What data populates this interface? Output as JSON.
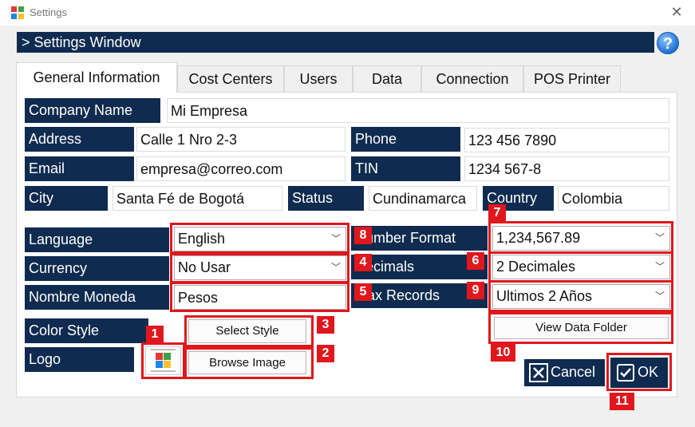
{
  "window": {
    "title": "Settings",
    "close_icon": "close-icon"
  },
  "header": {
    "title": "> Settings Window",
    "help": "?"
  },
  "tabs": [
    "General Information",
    "Cost Centers",
    "Users",
    "Data",
    "Connection",
    "POS Printer"
  ],
  "form": {
    "company_name": {
      "label": "Company Name",
      "value": "Mi Empresa"
    },
    "address": {
      "label": "Address",
      "value": "Calle 1 Nro 2-3"
    },
    "phone": {
      "label": "Phone",
      "value": "123 456 7890"
    },
    "email": {
      "label": "Email",
      "value": "empresa@correo.com"
    },
    "tin": {
      "label": "TIN",
      "value": "1234 567-8"
    },
    "city": {
      "label": "City",
      "value": "Santa Fé de Bogotá"
    },
    "status": {
      "label": "Status",
      "value": "Cundinamarca"
    },
    "country": {
      "label": "Country",
      "value": "Colombia"
    },
    "language": {
      "label": "Language",
      "value": "English"
    },
    "currency": {
      "label": "Currency",
      "value": "No Usar"
    },
    "currency_name": {
      "label": "Nombre Moneda",
      "value": "Pesos"
    },
    "color_style": {
      "label": "Color Style",
      "button": "Select Style"
    },
    "logo": {
      "label": "Logo",
      "button": "Browse Image"
    },
    "number_format": {
      "label": "Number Format",
      "value": "1,234,567.89"
    },
    "decimals": {
      "label": "Decimals",
      "value": "2 Decimales"
    },
    "max_records": {
      "label": "Max Records",
      "value": "Ultimos 2 Años"
    },
    "view_data_folder": "View Data Folder"
  },
  "footer": {
    "cancel": "Cancel",
    "ok": "OK"
  },
  "annotations": [
    "1",
    "2",
    "3",
    "4",
    "5",
    "6",
    "7",
    "8",
    "9",
    "10",
    "11"
  ],
  "colors": {
    "navy": "#0f2b4f",
    "highlight_red": "#e0171d"
  }
}
